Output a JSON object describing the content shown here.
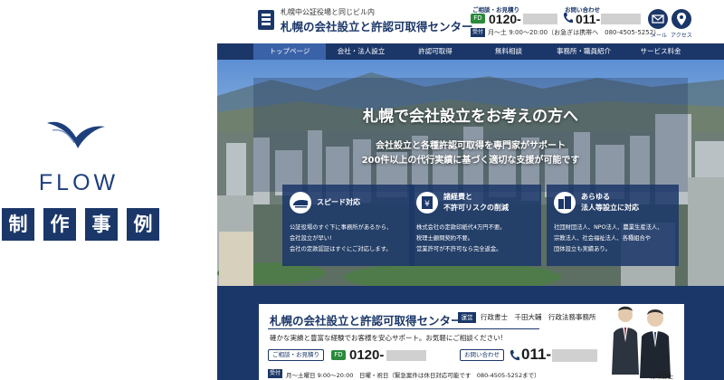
{
  "brand": {
    "name": "FLOW",
    "caption_chars": [
      "制",
      "作",
      "事",
      "例"
    ],
    "color": "#1b3769"
  },
  "site": {
    "header": {
      "logo_subtitle": "札幌中公証役場と同じビル内",
      "logo_title": "札幌の会社設立と許認可取得センター",
      "consult_label": "ご相談・お見積り",
      "free_dial_badge": "FD",
      "free_dial_number": "0120-",
      "inquiry_label": "お問い合わせ",
      "tel_number": "011-",
      "uketsuke": "受付",
      "hours": "月〜土 9:00〜20:00（お急ぎは携帯へ　080-4505-5252）",
      "mail_label": "メール",
      "access_label": "アクセス"
    },
    "nav": [
      "トップページ",
      "会社・法人設立",
      "許認可取得",
      "無料相談",
      "事務所・職員紹介",
      "サービス料金"
    ],
    "hero": {
      "title": "札幌で会社設立をお考えの方へ",
      "sub1": "会社設立と各種許認可取得を専門家がサポート",
      "sub2": "200件以上の代行実績に基づく適切な支援が可能です"
    },
    "features": [
      {
        "icon": "bullet-train-icon",
        "title1": "スピード対応",
        "title2": "",
        "lines": [
          "公証役場のすぐ下に事務所があるから、",
          "会社設立が早い!",
          "会社の定款認証はすぐにご対応します。"
        ]
      },
      {
        "icon": "yen-icon",
        "title1": "諸経費と",
        "title2": "不許可リスクの削減",
        "lines": [
          "株式会社の定款印紙代4万円不要。",
          "税理士顧問契約不要。",
          "営業許可が不許可なら完全返金。"
        ]
      },
      {
        "icon": "building-icon",
        "title1": "あらゆる",
        "title2": "法人等設立に対応",
        "lines": [
          "社団財団法人、NPO法人、農業生産法人、",
          "宗教法人、社会福祉法人、各種組合や",
          "団体設立も実績あり。"
        ]
      }
    ],
    "contact_card": {
      "title": "札幌の会社設立と許認可取得センター",
      "unei": "運営",
      "office": "行政書士　千田大輔　行政法務事務所",
      "desc": "確かな実績と豊富な経験でお客様を安心サポート。お気軽にご相談ください!",
      "consult_label": "ご相談・お見積り",
      "free_dial_number": "0120-",
      "inquiry_label": "お問い合わせ",
      "tel_number": "011-",
      "uketsuke": "受付",
      "hours": "月〜土曜日 9:00〜20:00　日曜・祝日（緊急案件は休日対応可能です　080-4505-5252まで）",
      "person_caption": "行政書士"
    }
  }
}
